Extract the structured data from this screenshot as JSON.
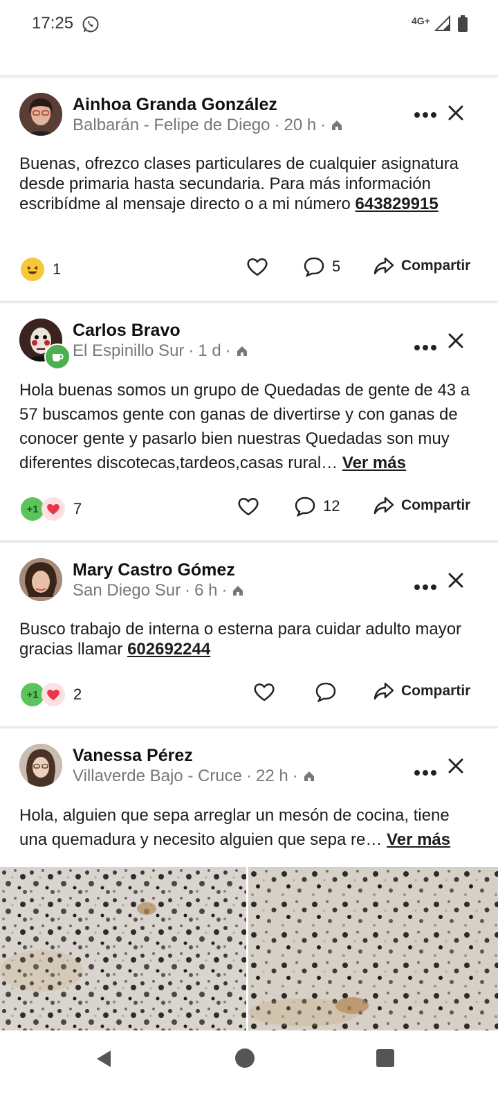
{
  "status_bar": {
    "time": "17:25",
    "network": "4G+"
  },
  "posts": [
    {
      "author": "Ainhoa Granda González",
      "location": "Balbarán - Felipe de Diego",
      "age": "20 h",
      "text": "Buenas, ofrezco clases particulares de cualquier asignatura desde primaria hasta secundaria. Para más información escribídme al mensaje directo o a mi número",
      "phone": "643829915",
      "reaction_count": "1",
      "comment_count": "5",
      "share_label": "Compartir"
    },
    {
      "author": "Carlos Bravo",
      "location": "El Espinillo Sur",
      "age": "1 d",
      "text": "Hola buenas somos un grupo de Quedadas de gente de 43 a 57 buscamos gente con ganas de divertirse y con ganas de conocer gente y pasarlo bien nuestras Quedadas son muy diferentes discotecas,tardeos,casas rural…",
      "see_more": "Ver más",
      "reaction_count": "7",
      "comment_count": "12",
      "share_label": "Compartir"
    },
    {
      "author": "Mary Castro Gómez",
      "location": "San Diego Sur",
      "age": "6 h",
      "text": "Busco trabajo de interna o esterna para cuidar adulto mayor gracias llamar",
      "phone": "602692244",
      "reaction_count": "2",
      "share_label": "Compartir"
    },
    {
      "author": "Vanessa Pérez",
      "location": "Villaverde Bajo - Cruce",
      "age": "22 h",
      "text": "Hola, alguien que sepa arreglar un mesón de cocina, tiene una quemadura y necesito alguien que sepa re…",
      "see_more": "Ver más"
    }
  ],
  "icons": {
    "home": "home-icon",
    "more": "more-icon",
    "close": "close-icon",
    "like": "heart-icon",
    "comment": "comment-icon",
    "share": "share-icon",
    "back": "back-icon",
    "home_nav": "home-nav-icon",
    "recents": "recents-icon"
  },
  "colors": {
    "heart_red": "#e8374a",
    "plus_green": "#5cc45c",
    "laugh_yellow": "#f7c63a",
    "badge_green": "#4caf50"
  }
}
